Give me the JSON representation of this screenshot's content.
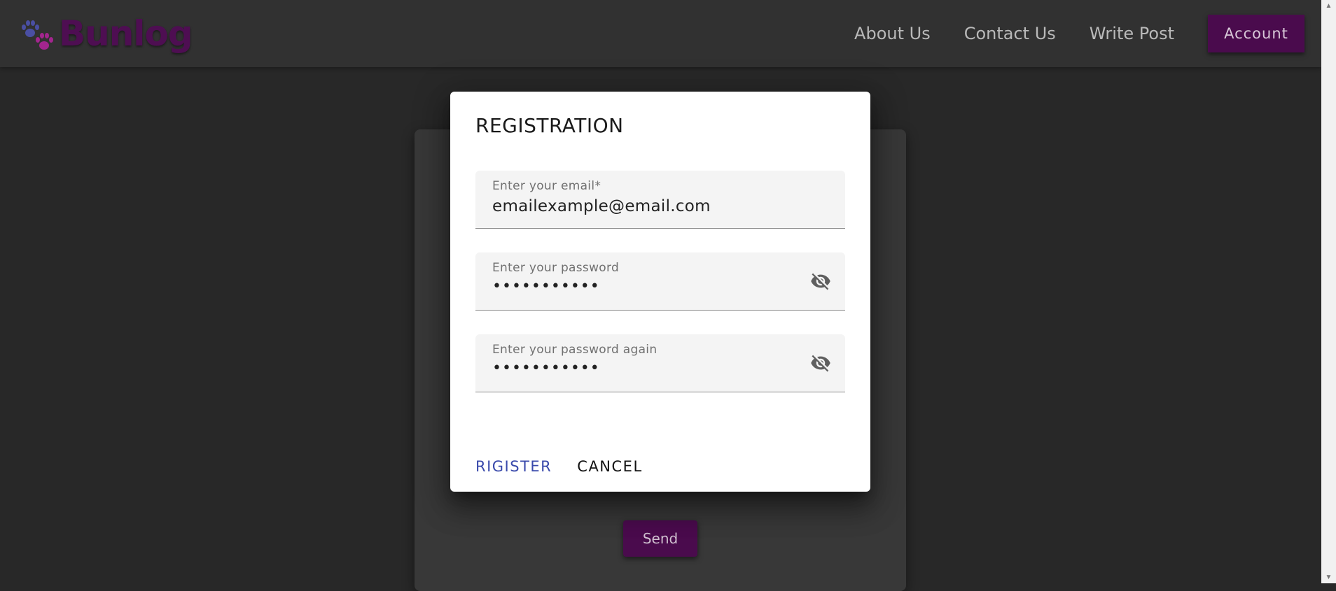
{
  "brand": {
    "name": "Bunlog"
  },
  "nav": {
    "links": [
      "About Us",
      "Contact Us",
      "Write Post"
    ],
    "account_label": "Account"
  },
  "background_card": {
    "send_label": "Send"
  },
  "dialog": {
    "title": "REGISTRATION",
    "email": {
      "label": "Enter your email*",
      "value": "emailexample@email.com"
    },
    "password": {
      "label": "Enter your password",
      "value": "•••••••••••"
    },
    "password_again": {
      "label": "Enter your password again",
      "value": "•••••••••••"
    },
    "register_label": "RIGISTER",
    "cancel_label": "CANCEL"
  },
  "colors": {
    "brand": "#4e0e52",
    "accent_button": "#4a0b4d",
    "primary_action": "#3949ab"
  },
  "icons": {
    "logo": "paw-icon",
    "password_toggle": "eye-off-icon"
  }
}
